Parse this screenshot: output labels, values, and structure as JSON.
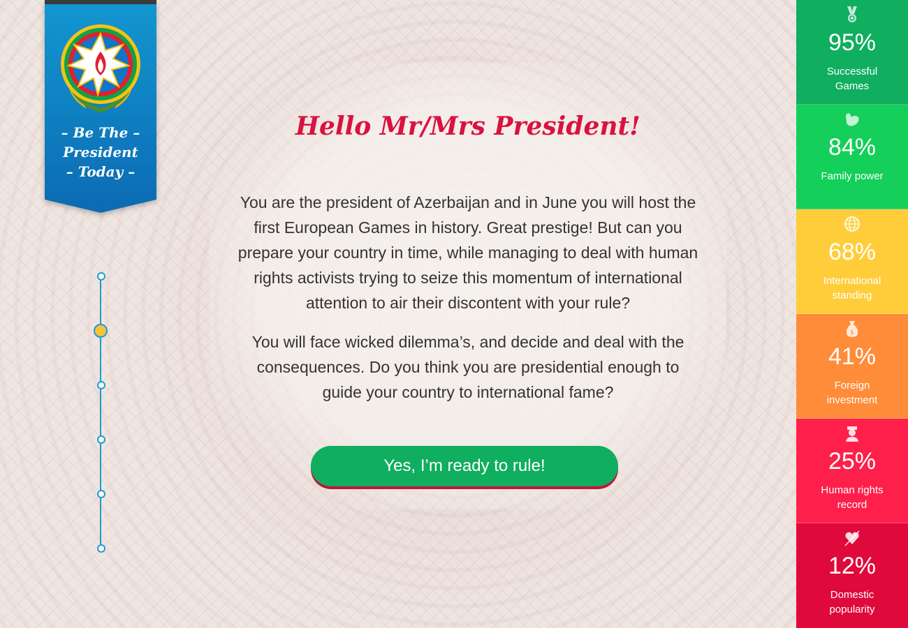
{
  "ribbon": {
    "line1": "– Be The –",
    "line2": "President",
    "line3": "– Today –"
  },
  "timeline": {
    "steps": 6,
    "active_step": 2
  },
  "intro": {
    "title": "Hello Mr/Mrs President!",
    "paragraph1": "You are the president of Azerbaijan and in June you will host the first European Games in history. Great prestige! But can you prepare your country in time, while managing to deal with human rights activists trying to seize this momentum of international attention to air their discontent with your rule?",
    "paragraph2": "You will face wicked dilemma’s, and decide and deal with the consequences. Do you think you are presidential enough to guide your country to international fame?",
    "cta_label": "Yes, I’m ready to rule!"
  },
  "stats": [
    {
      "value": "95%",
      "label": "Successful Games",
      "color": "#10ae5f",
      "icon": "medal-icon"
    },
    {
      "value": "84%",
      "label": "Family power",
      "color": "#14cf5a",
      "icon": "muscle-icon"
    },
    {
      "value": "68%",
      "label": "International standing",
      "color": "#ffcd3a",
      "icon": "globe-icon"
    },
    {
      "value": "41%",
      "label": "Foreign investment",
      "color": "#ff8c38",
      "icon": "money-bag-icon"
    },
    {
      "value": "25%",
      "label": "Human rights record",
      "color": "#ff1f4b",
      "icon": "officer-icon"
    },
    {
      "value": "12%",
      "label": "Domestic popularity",
      "color": "#e0093c",
      "icon": "heart-icon"
    }
  ]
}
